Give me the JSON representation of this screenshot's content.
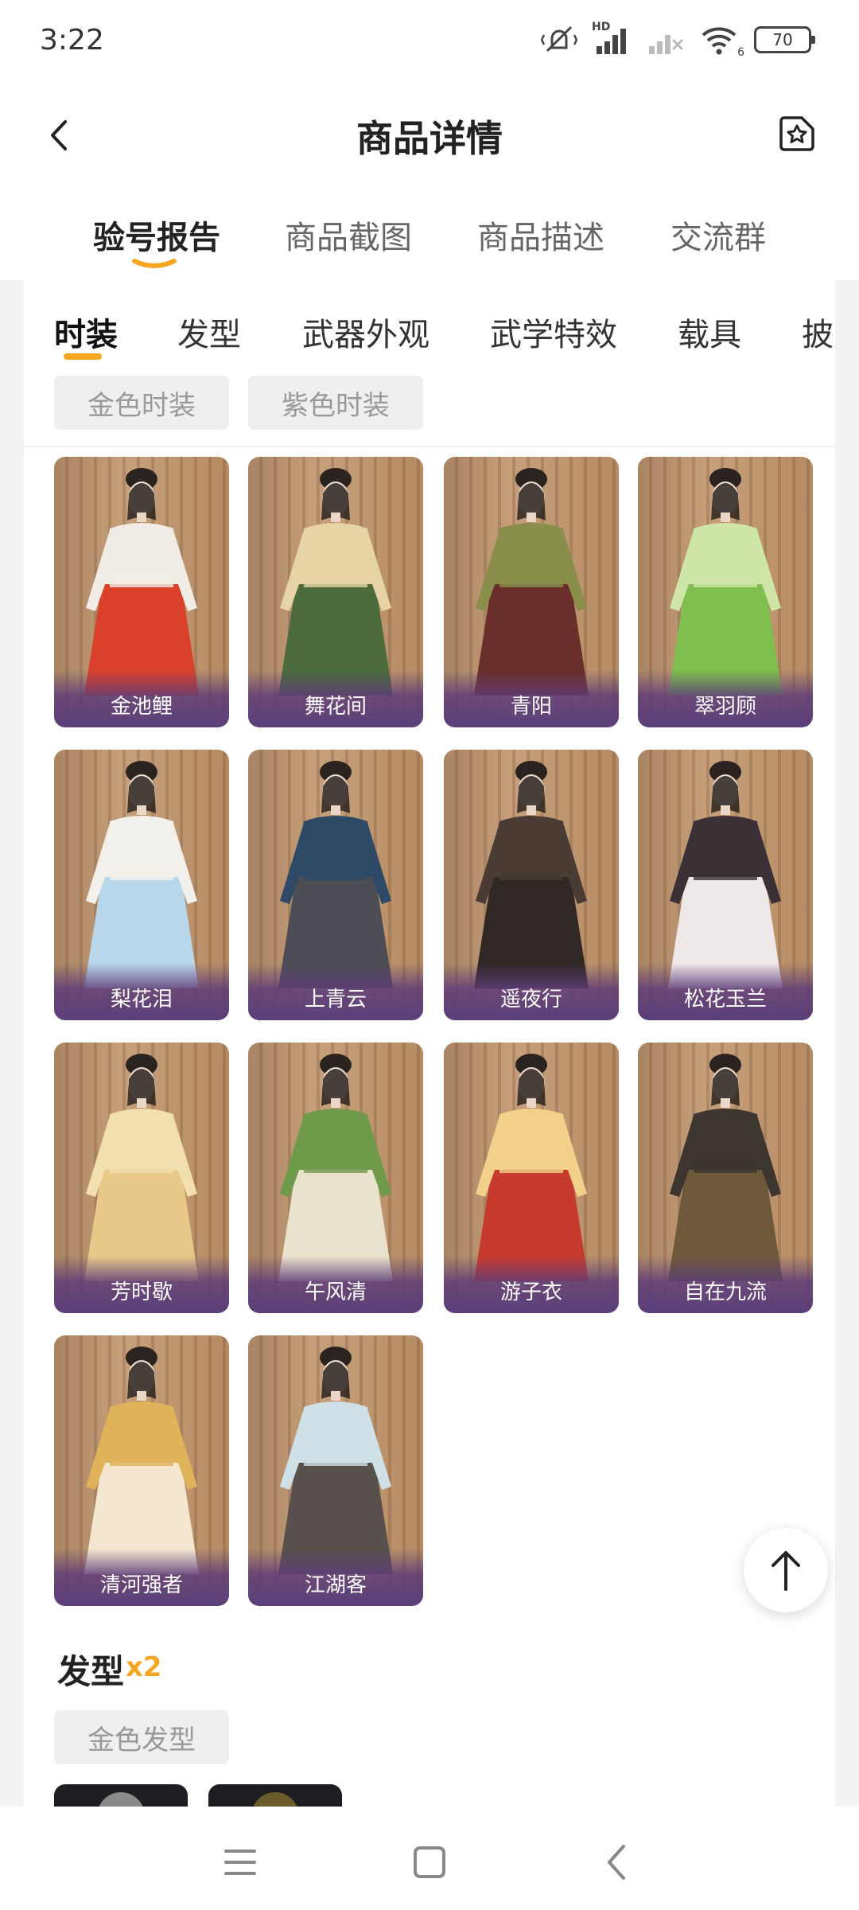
{
  "status_bar": {
    "time": "3:22",
    "battery": "70",
    "signal_tag": "HD",
    "wifi_tag": "6"
  },
  "header": {
    "title": "商品详情"
  },
  "tabs": [
    {
      "label": "验号报告",
      "active": true
    },
    {
      "label": "商品截图",
      "active": false
    },
    {
      "label": "商品描述",
      "active": false
    },
    {
      "label": "交流群",
      "active": false
    }
  ],
  "sub_tabs": [
    {
      "label": "时装",
      "active": true
    },
    {
      "label": "发型",
      "active": false
    },
    {
      "label": "武器外观",
      "active": false
    },
    {
      "label": "武学特效",
      "active": false
    },
    {
      "label": "载具",
      "active": false
    },
    {
      "label": "披风",
      "active": false
    }
  ],
  "filters": [
    "金色时装",
    "紫色时装"
  ],
  "outfits": [
    {
      "name": "金池鲤"
    },
    {
      "name": "舞花间"
    },
    {
      "name": "青阳"
    },
    {
      "name": "翠羽顾"
    },
    {
      "name": "梨花泪"
    },
    {
      "name": "上青云"
    },
    {
      "name": "遥夜行"
    },
    {
      "name": "松花玉兰"
    },
    {
      "name": "芳时歇"
    },
    {
      "name": "午风清"
    },
    {
      "name": "游子衣"
    },
    {
      "name": "自在九流"
    },
    {
      "name": "清河强者"
    },
    {
      "name": "江湖客"
    }
  ],
  "hair_section": {
    "title": "发型",
    "count": "x2",
    "filter": "金色发型"
  },
  "colors": {
    "accent": "#f5a623",
    "label_bar": "#5b3f7a"
  }
}
